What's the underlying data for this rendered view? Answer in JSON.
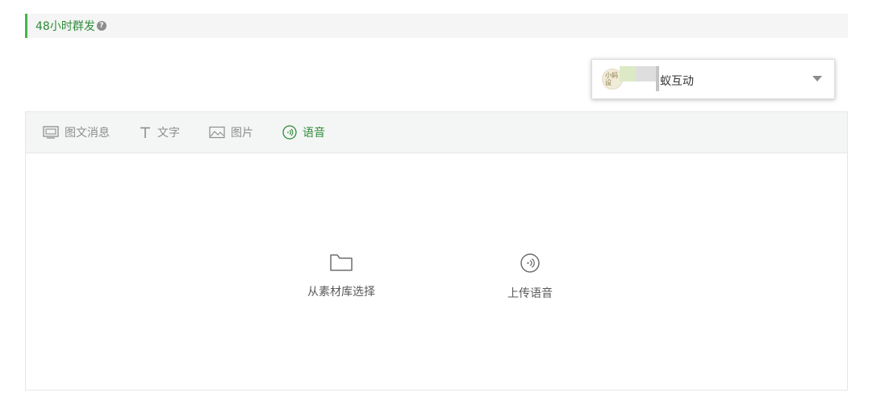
{
  "section": {
    "title": "48小时群发",
    "help_glyph": "?"
  },
  "account": {
    "avatar_text": "小蚂\n设",
    "name": "蚁互动"
  },
  "tabs": [
    {
      "label": "图文消息",
      "icon": "news-icon",
      "active": false
    },
    {
      "label": "文字",
      "icon": "text-icon",
      "active": false
    },
    {
      "label": "图片",
      "icon": "image-icon",
      "active": false
    },
    {
      "label": "语音",
      "icon": "voice-icon",
      "active": true
    }
  ],
  "actions": {
    "library_label": "从素材库选择",
    "upload_label": "上传语音"
  },
  "colors": {
    "accent": "#44b549",
    "accent_text": "#2e8b3a",
    "muted": "#8d8d8d"
  }
}
